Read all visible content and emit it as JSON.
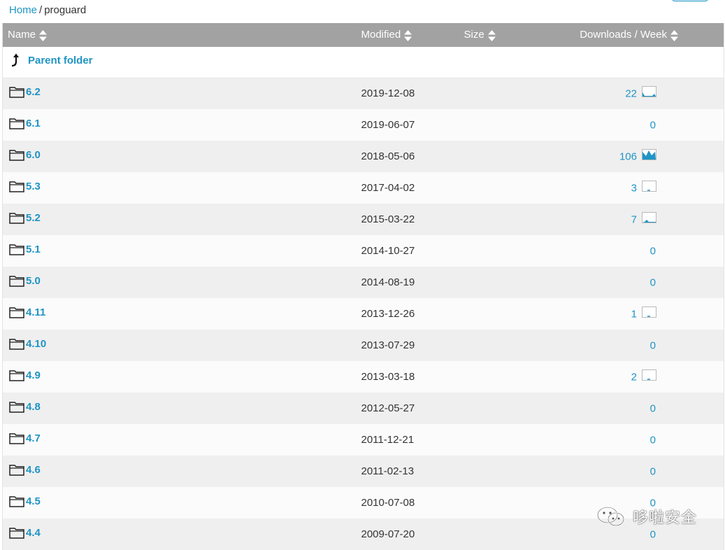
{
  "breadcrumb": {
    "home": "Home",
    "separator": "/",
    "current": "proguard"
  },
  "table": {
    "columns": {
      "name": "Name",
      "modified": "Modified",
      "size": "Size",
      "downloads": "Downloads / Week"
    },
    "parent_label": "Parent folder",
    "rows": [
      {
        "name": "6.2",
        "modified": "2019-12-08",
        "downloads": "22",
        "sparkline": true
      },
      {
        "name": "6.1",
        "modified": "2019-06-07",
        "downloads": "0",
        "sparkline": false
      },
      {
        "name": "6.0",
        "modified": "2018-05-06",
        "downloads": "106",
        "sparkline": true
      },
      {
        "name": "5.3",
        "modified": "2017-04-02",
        "downloads": "3",
        "sparkline": true
      },
      {
        "name": "5.2",
        "modified": "2015-03-22",
        "downloads": "7",
        "sparkline": true
      },
      {
        "name": "5.1",
        "modified": "2014-10-27",
        "downloads": "0",
        "sparkline": false
      },
      {
        "name": "5.0",
        "modified": "2014-08-19",
        "downloads": "0",
        "sparkline": false
      },
      {
        "name": "4.11",
        "modified": "2013-12-26",
        "downloads": "1",
        "sparkline": true
      },
      {
        "name": "4.10",
        "modified": "2013-07-29",
        "downloads": "0",
        "sparkline": false
      },
      {
        "name": "4.9",
        "modified": "2013-03-18",
        "downloads": "2",
        "sparkline": true
      },
      {
        "name": "4.8",
        "modified": "2012-05-27",
        "downloads": "0",
        "sparkline": false
      },
      {
        "name": "4.7",
        "modified": "2011-12-21",
        "downloads": "0",
        "sparkline": false
      },
      {
        "name": "4.6",
        "modified": "2011-02-13",
        "downloads": "0",
        "sparkline": false
      },
      {
        "name": "4.5",
        "modified": "2010-07-08",
        "downloads": "0",
        "sparkline": false
      },
      {
        "name": "4.4",
        "modified": "2009-07-20",
        "downloads": "0",
        "sparkline": false
      }
    ]
  },
  "watermark": {
    "text": "哆啦安全",
    "icon": "wechat-icon"
  },
  "colors": {
    "link": "#1f94c5",
    "header_bg": "#a2a2a2",
    "row_alt": "#efefef",
    "row": "#fbfbfb"
  }
}
